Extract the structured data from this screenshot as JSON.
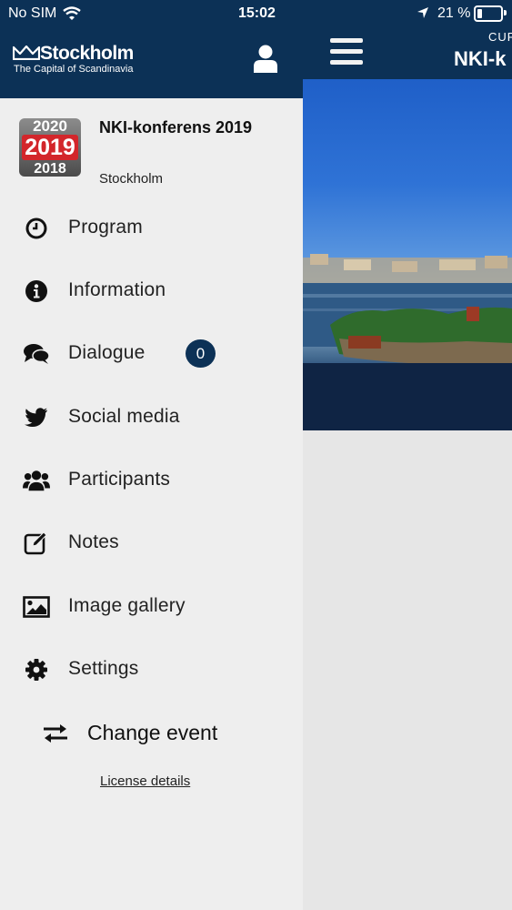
{
  "status_bar": {
    "carrier": "No SIM",
    "time": "15:02",
    "battery": "21 %",
    "battery_level": 0.21
  },
  "drawer": {
    "logo": {
      "wordmark": "Stockholm",
      "tagline": "The Capital of Scandinavia"
    },
    "user_icon": "user-icon",
    "event": {
      "name": "NKI-konferens 2019",
      "location": "Stockholm",
      "image_years": [
        "2020",
        "2019",
        "2018"
      ]
    },
    "menu": [
      {
        "label": "Program",
        "icon": "clock-icon"
      },
      {
        "label": "Information",
        "icon": "info-icon"
      },
      {
        "label": "Dialogue",
        "icon": "chat-icon",
        "badge": "0"
      },
      {
        "label": "Social media",
        "icon": "twitter-icon"
      },
      {
        "label": "Participants",
        "icon": "users-icon"
      },
      {
        "label": "Notes",
        "icon": "edit-icon"
      },
      {
        "label": "Image gallery",
        "icon": "image-icon"
      },
      {
        "label": "Settings",
        "icon": "gear-icon"
      }
    ],
    "change_event": "Change event",
    "license": "License details"
  },
  "main": {
    "small_title": "CUR",
    "title": "NKI-k"
  },
  "colors": {
    "navy": "#0c3156",
    "drawer_bg": "#eeeeee",
    "badge": "#0c3156"
  }
}
